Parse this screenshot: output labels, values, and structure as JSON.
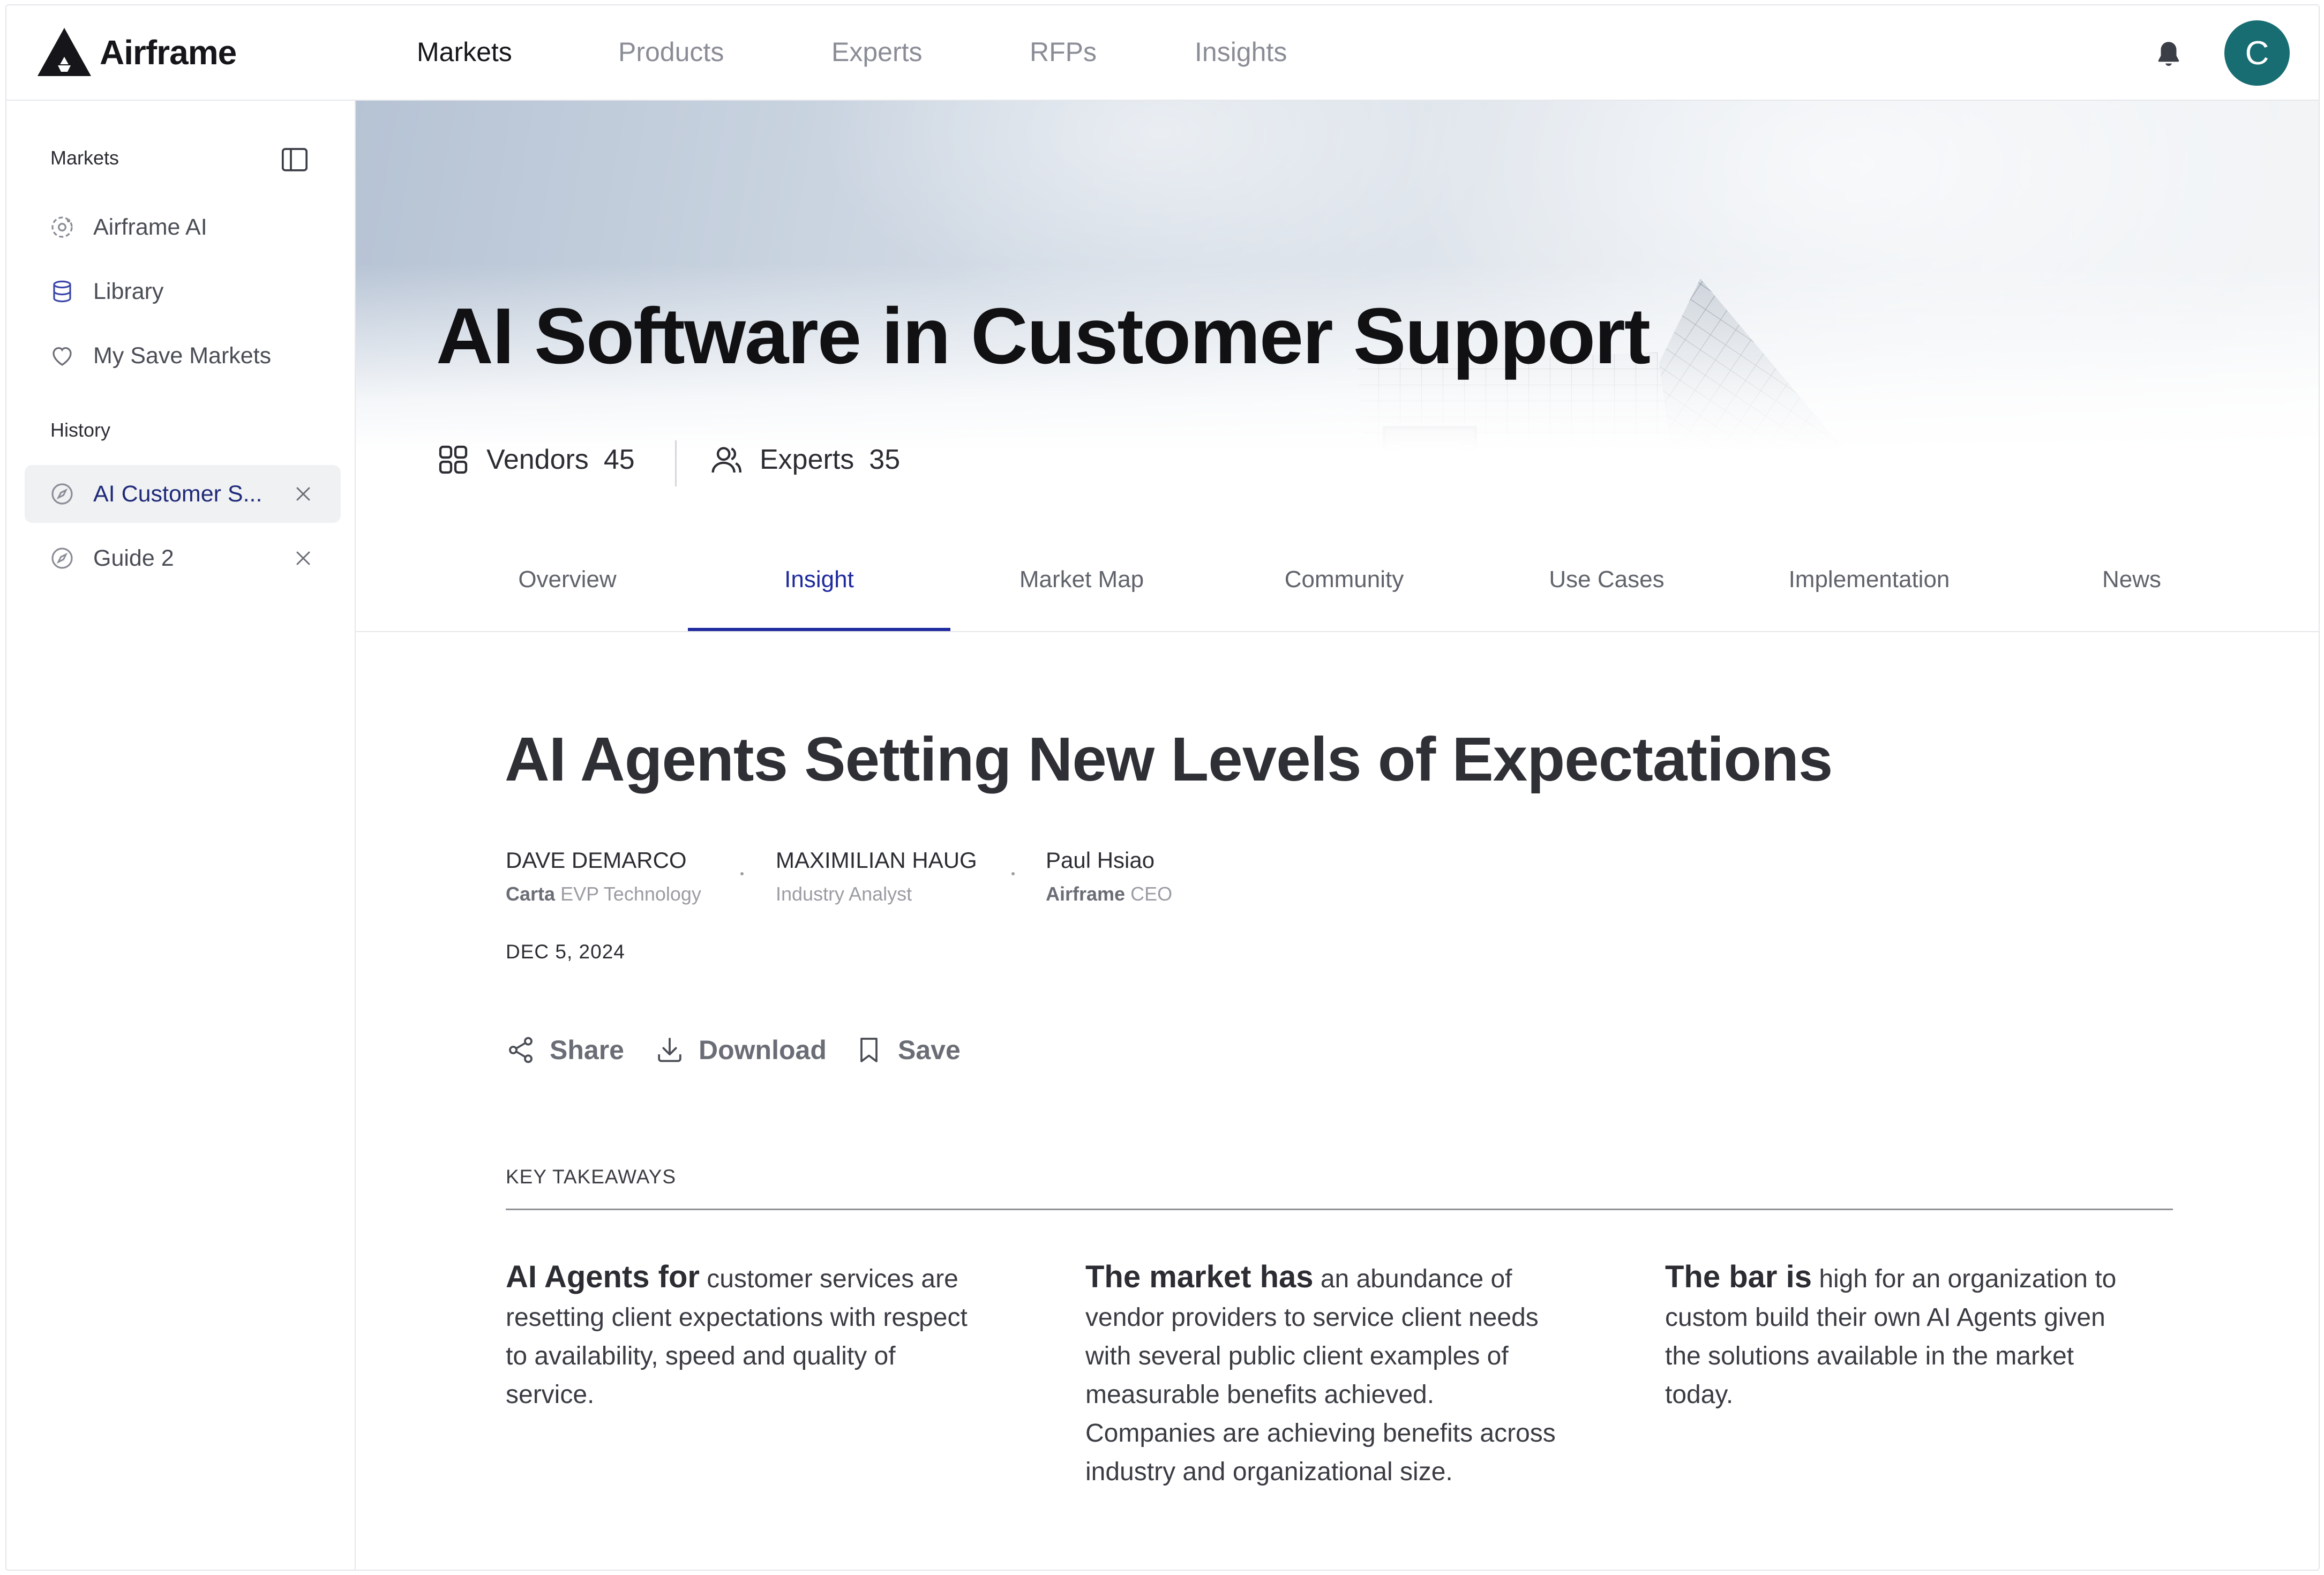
{
  "app": {
    "brand": "Airframe",
    "accent_color": "#1e2a9e",
    "avatar_color": "#176d72"
  },
  "topnav": {
    "items": [
      {
        "label": "Markets",
        "active": true
      },
      {
        "label": "Products",
        "active": false
      },
      {
        "label": "Experts",
        "active": false
      },
      {
        "label": "RFPs",
        "active": false
      },
      {
        "label": "Insights",
        "active": false
      }
    ],
    "notifications_icon": "bell-icon",
    "avatar_initial": "C"
  },
  "sidebar": {
    "section_markets": "Markets",
    "markets_items": [
      {
        "label": "Airframe AI",
        "icon": "ai-orbit-icon"
      },
      {
        "label": "Library",
        "icon": "database-icon"
      },
      {
        "label": "My Save Markets",
        "icon": "heart-icon"
      }
    ],
    "section_history": "History",
    "history_items": [
      {
        "label": "AI Customer S...",
        "icon": "compass-icon",
        "selected": true
      },
      {
        "label": "Guide 2",
        "icon": "compass-icon",
        "selected": false
      }
    ]
  },
  "hero": {
    "title": "AI Software in Customer Support",
    "stats": [
      {
        "label": "Vendors",
        "value": "45",
        "icon": "grid-icon"
      },
      {
        "label": "Experts",
        "value": "35",
        "icon": "users-icon"
      }
    ]
  },
  "tabs": [
    {
      "label": "Overview",
      "active": false
    },
    {
      "label": "Insight",
      "active": true
    },
    {
      "label": "Market Map",
      "active": false
    },
    {
      "label": "Community",
      "active": false
    },
    {
      "label": "Use Cases",
      "active": false
    },
    {
      "label": "Implementation",
      "active": false
    },
    {
      "label": "News",
      "active": false
    }
  ],
  "article": {
    "title": "AI Agents Setting New Levels of Expectations",
    "authors": [
      {
        "name": "DAVE DEMARCO",
        "org": "Carta",
        "role": "EVP Technology"
      },
      {
        "name": "MAXIMILIAN HAUG",
        "org": "",
        "role": "Industry Analyst"
      },
      {
        "name": "Paul Hsiao",
        "org": "Airframe",
        "role": "CEO"
      }
    ],
    "date": "DEC 5, 2024",
    "actions": [
      {
        "label": "Share",
        "icon": "share-icon"
      },
      {
        "label": "Download",
        "icon": "download-icon"
      },
      {
        "label": "Save",
        "icon": "bookmark-icon"
      }
    ],
    "key_takeaways_label": "KEY TAKEAWAYS",
    "takeaways": [
      {
        "lead": "AI Agents for",
        "text": " customer services are resetting client expectations with respect to availability, speed and quality of service."
      },
      {
        "lead": "The market has",
        "text": " an abundance of vendor providers to service client needs with several public client examples of measurable benefits achieved. Companies are achieving benefits across industry and organizational size."
      },
      {
        "lead": "The bar is",
        "text": " high for an organization to custom build their own AI Agents given the solutions available in the market today."
      }
    ]
  }
}
